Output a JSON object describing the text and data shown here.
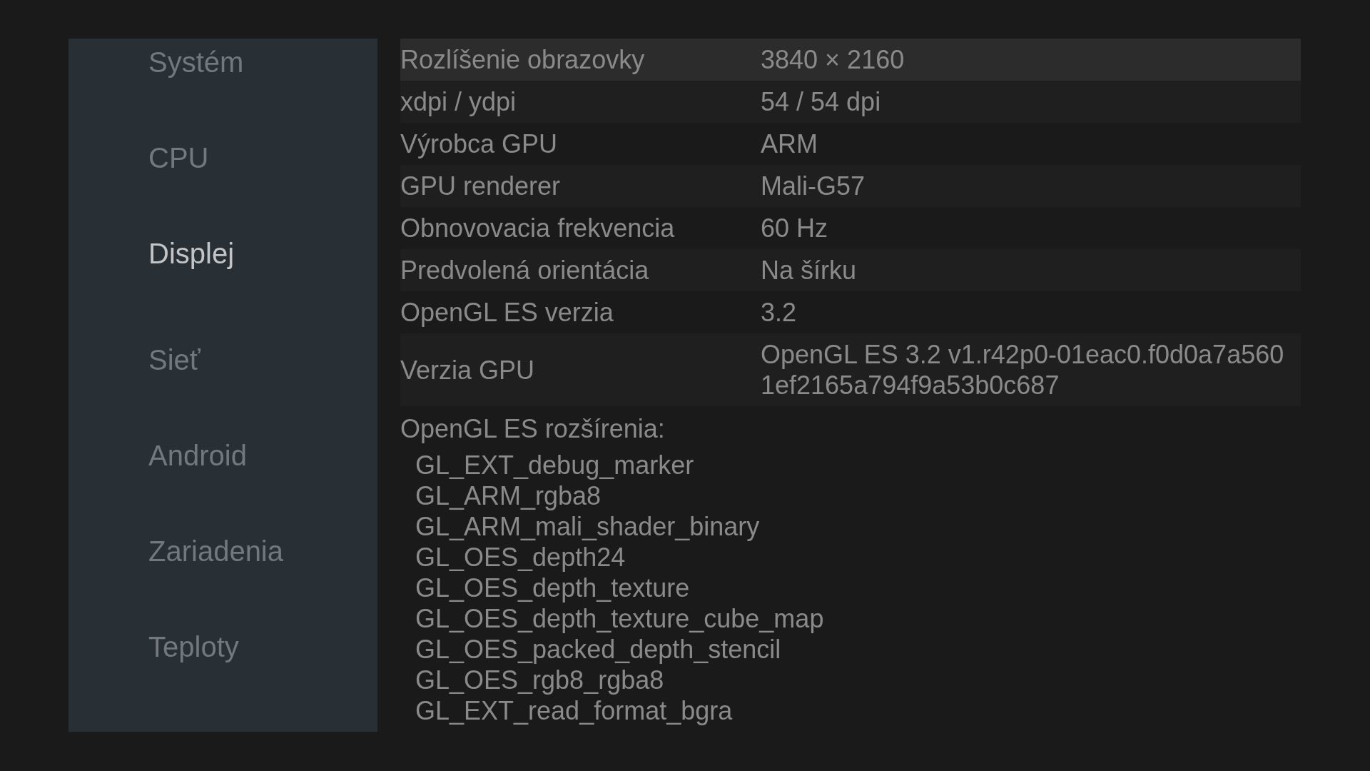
{
  "sidebar": {
    "items": [
      {
        "label": "Systém",
        "selected": false
      },
      {
        "label": "CPU",
        "selected": false
      },
      {
        "label": "Displej",
        "selected": true
      },
      {
        "label": "Sieť",
        "selected": false
      },
      {
        "label": "Android",
        "selected": false
      },
      {
        "label": "Zariadenia",
        "selected": false
      },
      {
        "label": "Teploty",
        "selected": false
      }
    ]
  },
  "info_table": {
    "rows": [
      {
        "label": "Rozlíšenie obrazovky",
        "value": "3840 × 2160",
        "selected": true
      },
      {
        "label": "xdpi / ydpi",
        "value": "54 / 54 dpi",
        "selected": false
      },
      {
        "label": "Výrobca GPU",
        "value": "ARM",
        "selected": false
      },
      {
        "label": "GPU renderer",
        "value": "Mali-G57",
        "selected": false
      },
      {
        "label": "Obnovovacia frekvencia",
        "value": "60 Hz",
        "selected": false
      },
      {
        "label": "Predvolená orientácia",
        "value": "Na šírku",
        "selected": false
      },
      {
        "label": "OpenGL ES verzia",
        "value": "3.2",
        "selected": false
      },
      {
        "label": "Verzia GPU",
        "value": "OpenGL ES 3.2 v1.r42p0-01eac0.f0d0a7a5601ef2165a794f9a53b0c687",
        "selected": false
      }
    ]
  },
  "extensions": {
    "title": "OpenGL ES rozšírenia:",
    "items": [
      "GL_EXT_debug_marker",
      "GL_ARM_rgba8",
      "GL_ARM_mali_shader_binary",
      "GL_OES_depth24",
      "GL_OES_depth_texture",
      "GL_OES_depth_texture_cube_map",
      "GL_OES_packed_depth_stencil",
      "GL_OES_rgb8_rgba8",
      "GL_EXT_read_format_bgra"
    ]
  }
}
